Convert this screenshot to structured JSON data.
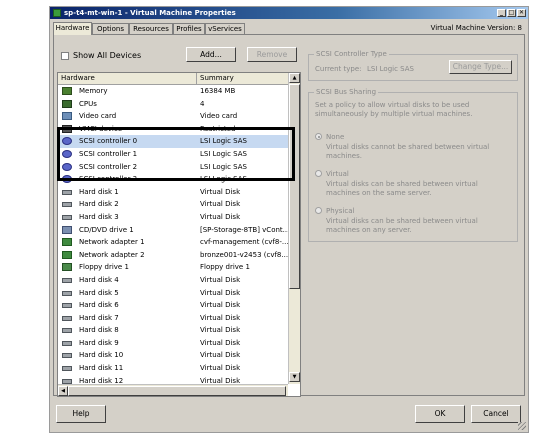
{
  "window": {
    "title": "sp-t4-mt-win-1 - Virtual Machine Properties",
    "version": "Virtual Machine Version: 8"
  },
  "tabs": [
    "Hardware",
    "Options",
    "Resources",
    "Profiles",
    "vServices"
  ],
  "toolbar": {
    "show_all_devices": "Show All Devices",
    "add": "Add...",
    "remove": "Remove"
  },
  "table": {
    "headers": {
      "hardware": "Hardware",
      "summary": "Summary"
    },
    "rows": [
      {
        "icon": "memory-icon",
        "name": "Memory",
        "summary": "16384 MB"
      },
      {
        "icon": "cpu-icon",
        "name": "CPUs",
        "summary": "4"
      },
      {
        "icon": "video-card-icon",
        "name": "Video card",
        "summary": "Video card"
      },
      {
        "icon": "vmci-icon",
        "name": "VMCI device",
        "summary": "Restricted"
      },
      {
        "icon": "scsi-controller-icon",
        "name": "SCSI controller 0",
        "summary": "LSI Logic SAS"
      },
      {
        "icon": "scsi-controller-icon",
        "name": "SCSI controller 1",
        "summary": "LSI Logic SAS"
      },
      {
        "icon": "scsi-controller-icon",
        "name": "SCSI controller 2",
        "summary": "LSI Logic SAS"
      },
      {
        "icon": "scsi-controller-icon",
        "name": "SCSI controller 3",
        "summary": "LSI Logic SAS"
      },
      {
        "icon": "hard-disk-icon",
        "name": "Hard disk 1",
        "summary": "Virtual Disk"
      },
      {
        "icon": "hard-disk-icon",
        "name": "Hard disk 2",
        "summary": "Virtual Disk"
      },
      {
        "icon": "hard-disk-icon",
        "name": "Hard disk 3",
        "summary": "Virtual Disk"
      },
      {
        "icon": "cd-dvd-icon",
        "name": "CD/DVD drive 1",
        "summary": "[SP-Storage-8TB] vCont..."
      },
      {
        "icon": "network-adapter-icon",
        "name": "Network adapter 1",
        "summary": "cvf-management (cvf8-..."
      },
      {
        "icon": "network-adapter-icon",
        "name": "Network adapter 2",
        "summary": "bronze001-v2453 (cvf8..."
      },
      {
        "icon": "floppy-icon",
        "name": "Floppy drive 1",
        "summary": "Floppy drive 1"
      },
      {
        "icon": "hard-disk-icon",
        "name": "Hard disk 4",
        "summary": "Virtual Disk"
      },
      {
        "icon": "hard-disk-icon",
        "name": "Hard disk 5",
        "summary": "Virtual Disk"
      },
      {
        "icon": "hard-disk-icon",
        "name": "Hard disk 6",
        "summary": "Virtual Disk"
      },
      {
        "icon": "hard-disk-icon",
        "name": "Hard disk 7",
        "summary": "Virtual Disk"
      },
      {
        "icon": "hard-disk-icon",
        "name": "Hard disk 8",
        "summary": "Virtual Disk"
      },
      {
        "icon": "hard-disk-icon",
        "name": "Hard disk 9",
        "summary": "Virtual Disk"
      },
      {
        "icon": "hard-disk-icon",
        "name": "Hard disk 10",
        "summary": "Virtual Disk"
      },
      {
        "icon": "hard-disk-icon",
        "name": "Hard disk 11",
        "summary": "Virtual Disk"
      },
      {
        "icon": "hard-disk-icon",
        "name": "Hard disk 12",
        "summary": "Virtual Disk"
      }
    ]
  },
  "scsi_type": {
    "legend": "SCSI Controller Type",
    "current_label": "Current type:",
    "current_value": "LSI Logic SAS",
    "change_button": "Change Type..."
  },
  "bus_sharing": {
    "legend": "SCSI Bus Sharing",
    "description": "Set a policy to allow virtual disks to be used simultaneously by multiple virtual machines.",
    "options": [
      {
        "label": "None",
        "desc": "Virtual disks cannot be shared between virtual machines.",
        "checked": true
      },
      {
        "label": "Virtual",
        "desc": "Virtual disks can be shared between virtual machines on the same server.",
        "checked": false
      },
      {
        "label": "Physical",
        "desc": "Virtual disks can be shared between virtual machines on any server.",
        "checked": false
      }
    ]
  },
  "footer": {
    "help": "Help",
    "ok": "OK",
    "cancel": "Cancel"
  },
  "selected_row": 4,
  "icon_map": {
    "minimize": "_",
    "maximize": "□",
    "close": "✕",
    "scroll_up": "▲",
    "scroll_down": "▼",
    "scroll_left": "◀",
    "scroll_right": "▶"
  }
}
